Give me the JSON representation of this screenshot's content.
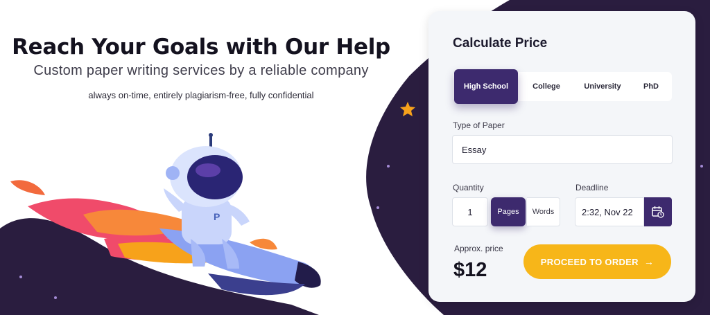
{
  "hero": {
    "title": "Reach Your Goals with Our Help",
    "subtitle": "Custom paper writing services by a reliable company",
    "tagline": "always on-time, entirely plagiarism-free, fully confidential"
  },
  "calculator": {
    "title": "Calculate Price",
    "levels": [
      {
        "label": "High School",
        "active": true
      },
      {
        "label": "College",
        "active": false
      },
      {
        "label": "University",
        "active": false
      },
      {
        "label": "PhD",
        "active": false
      }
    ],
    "type_of_paper": {
      "label": "Type of Paper",
      "value": "Essay"
    },
    "quantity": {
      "label": "Quantity",
      "value": "1",
      "units": [
        "Pages",
        "Words"
      ],
      "active_unit": "Pages"
    },
    "deadline": {
      "label": "Deadline",
      "value": "2:32, Nov 22",
      "icon": "calendar-icon"
    },
    "approx_price_label": "Approx. price",
    "price": "$12",
    "cta": {
      "label": "PROCEED TO ORDER",
      "arrow": "→"
    }
  },
  "colors": {
    "primary": "#3d2a6e",
    "accent": "#f7b619",
    "space_dark": "#2a1d3f",
    "card_bg": "#f4f6f9"
  }
}
